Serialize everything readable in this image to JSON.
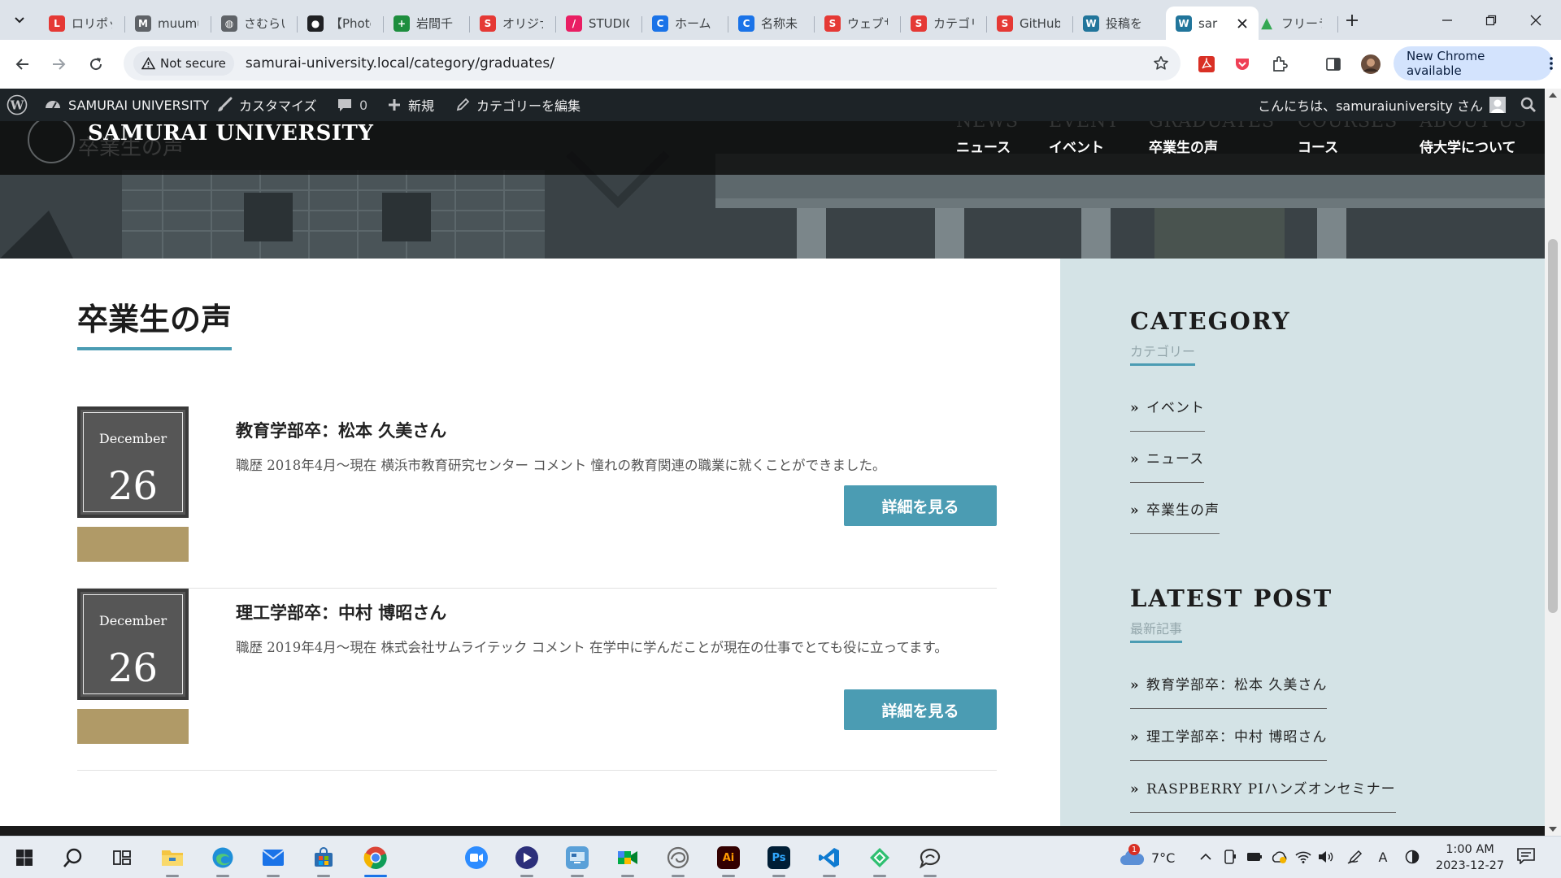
{
  "browser": {
    "tabs": [
      {
        "title": "ロリポッ",
        "color": "#e53935",
        "glyph": "L"
      },
      {
        "title": "muumu",
        "color": "#5f6368",
        "glyph": "M"
      },
      {
        "title": "さむらい",
        "color": "#5f6368",
        "glyph": "◍"
      },
      {
        "title": "【Photo",
        "color": "#202124",
        "glyph": "●"
      },
      {
        "title": "岩間千",
        "color": "#1e8e3e",
        "glyph": "+"
      },
      {
        "title": "オリジナ",
        "color": "#e53935",
        "glyph": "S"
      },
      {
        "title": "STUDIO",
        "color": "#e91e63",
        "glyph": "/"
      },
      {
        "title": "ホーム -",
        "color": "#1a73e8",
        "glyph": "C"
      },
      {
        "title": "名称未",
        "color": "#1a73e8",
        "glyph": "C"
      },
      {
        "title": "ウェブサ",
        "color": "#e53935",
        "glyph": "S"
      },
      {
        "title": "カテゴリ",
        "color": "#e53935",
        "glyph": "S"
      },
      {
        "title": "GitHub",
        "color": "#e53935",
        "glyph": "S"
      },
      {
        "title": "投稿を",
        "color": "#21759b",
        "glyph": "W"
      },
      {
        "title": "sar",
        "color": "#21759b",
        "glyph": "W",
        "active": true
      },
      {
        "title": "フリーラ",
        "color": "#34a853",
        "glyph": "▲"
      }
    ],
    "address": {
      "security_label": "Not secure",
      "url": "samurai-university.local/category/graduates/"
    },
    "update_label": "New Chrome available"
  },
  "wp_adminbar": {
    "site_name": "SAMURAI UNIVERSITY",
    "customize": "カスタマイズ",
    "comments_count": "0",
    "new": "新規",
    "edit_category": "カテゴリーを編集",
    "greeting": "こんにちは、samuraiuniversity さん"
  },
  "site": {
    "title": "SAMURAI UNIVERSITY",
    "ghost_title": "卒業生の声",
    "nav": [
      {
        "en": "NEWS",
        "ja": "ニュース"
      },
      {
        "en": "EVENT",
        "ja": "イベント"
      },
      {
        "en": "GRADUATES",
        "ja": "卒業生の声"
      },
      {
        "en": "COURSES",
        "ja": "コース"
      },
      {
        "en": "ABOUT US",
        "ja": "侍大学について"
      }
    ]
  },
  "main": {
    "page_title": "卒業生の声",
    "posts": [
      {
        "month": "December",
        "day": "26",
        "title": "教育学部卒：松本 久美さん",
        "excerpt": "職歴 2018年4月～現在 横浜市教育研究センター コメント 憧れの教育関連の職業に就くことができました。",
        "button": "詳細を見る"
      },
      {
        "month": "December",
        "day": "26",
        "title": "理工学部卒：中村 博昭さん",
        "excerpt": "職歴 2019年4月～現在 株式会社サムライテック コメント 在学中に学んだことが現在の仕事でとても役に立ってます。",
        "button": "詳細を見る"
      }
    ]
  },
  "sidebar": {
    "category": {
      "title": "CATEGORY",
      "subtitle": "カテゴリー",
      "items": [
        "イベント",
        "ニュース",
        "卒業生の声"
      ]
    },
    "latest": {
      "title": "LATEST POST",
      "subtitle": "最新記事",
      "items": [
        "教育学部卒：松本 久美さん",
        "理工学部卒：中村 博昭さん",
        "RASPBERRY PIハンズオンセミナー"
      ]
    }
  },
  "taskbar": {
    "weather_temp": "7°C",
    "weather_badge": "1",
    "ime": "A",
    "time": "1:00 AM",
    "date": "2023-12-27"
  },
  "colors": {
    "accent": "#4b9cb3",
    "category_strip": "#b09a67",
    "sidebar_bg": "#d4e3e6",
    "admin_bar": "#1d2327"
  }
}
